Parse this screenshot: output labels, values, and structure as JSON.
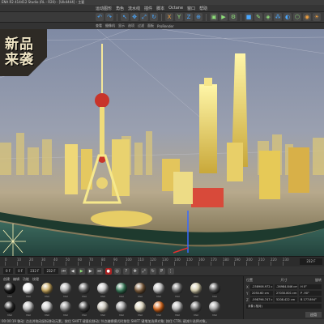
{
  "window": {
    "title": "ENA R2 414412 Studio (RL - R20) - [Ulk4444] - 主要"
  },
  "menu": {
    "items": [
      "运动图形",
      "角色",
      "流水线",
      "插件",
      "脚本",
      "Octane",
      "窗口",
      "帮助"
    ]
  },
  "viewport_header": {
    "items": [
      "查看",
      "摄像机",
      "显示",
      "选项",
      "过滤",
      "面板",
      "ProRender"
    ]
  },
  "badge": {
    "line1": "新品",
    "line2": "来袭"
  },
  "timeline": {
    "ticks": [
      "0",
      "10",
      "20",
      "30",
      "40",
      "50",
      "60",
      "70",
      "80",
      "90",
      "100",
      "110",
      "120",
      "130",
      "140",
      "150",
      "160",
      "170",
      "180",
      "190",
      "200",
      "210",
      "220",
      "230"
    ],
    "current_frame": "232 F"
  },
  "transport": {
    "start_field": "0 F",
    "start_field2": "0 F",
    "end_field": "232 F",
    "end_field2": "232 F"
  },
  "material": {
    "tabs": [
      "创建",
      "编辑",
      "功能",
      "纹理"
    ],
    "swatches": [
      {
        "label": "Mat",
        "color": "#1a1a1a"
      },
      {
        "label": "Mat",
        "color": "#f2f2f2"
      },
      {
        "label": "Mat",
        "color": "#c8a860"
      },
      {
        "label": "Mat",
        "color": "#b0b0b0"
      },
      {
        "label": "Mat",
        "color": "#606060"
      },
      {
        "label": "Mat",
        "color": "#c8c8c8"
      },
      {
        "label": "Mat",
        "color": "#3a7a5a"
      },
      {
        "label": "Mat",
        "color": "#806040"
      },
      {
        "label": "Mat",
        "color": "#c0c0c0"
      },
      {
        "label": "Mat",
        "color": "#707070"
      },
      {
        "label": "Mat",
        "color": "#d8d0b0"
      },
      {
        "label": "Mat",
        "color": "#505050"
      },
      {
        "label": "Mat",
        "color": "#2a2a2a"
      },
      {
        "label": "Mat",
        "color": "#bdbdbd"
      },
      {
        "label": "Mat",
        "color": "#d0d0d0"
      },
      {
        "label": "Mat",
        "color": "#8a8a8a"
      },
      {
        "label": "Mat",
        "color": "#404040"
      },
      {
        "label": "Mat",
        "color": "#c8c4b8"
      },
      {
        "label": "Mat",
        "color": "#9a9a9a"
      },
      {
        "label": "Mat",
        "color": "#e0d8c0"
      },
      {
        "label": "Mat",
        "color": "#d86a20"
      },
      {
        "label": "Mat",
        "color": "#b8b8b8"
      },
      {
        "label": "Mat",
        "color": "#686868"
      },
      {
        "label": "Mat",
        "color": "#a0a0a0"
      }
    ]
  },
  "coordinates": {
    "header": [
      "位置",
      "尺寸",
      "旋转"
    ],
    "rows": [
      {
        "axis": "X",
        "pos": "-258906.972 c",
        "size": "-26984.846 cm",
        "rot": "H 0°"
      },
      {
        "axis": "Y",
        "pos": "2050.60 cm",
        "size": "27030.801 cm",
        "rot": "P -90°"
      },
      {
        "axis": "Z",
        "pos": "-598796.747 c",
        "size": "5208.422 cm",
        "rot": "B 177.894°"
      }
    ],
    "mode": "对象 (相对)",
    "apply_label": "应用"
  },
  "status": {
    "text": "00:00:19  移动: 点击并拖动鼠标移动元素。按住 SHIFT 键量化移动; 节点编辑模式时按住 SHIFT 键增加选择对象; 按住 CTRL 键减少选择对象。"
  },
  "colors": {
    "sky_top": "#7f8aa4",
    "sky_bottom": "#b7a98c",
    "building_glow": "#f5e16a",
    "river": "#2f5a52"
  }
}
